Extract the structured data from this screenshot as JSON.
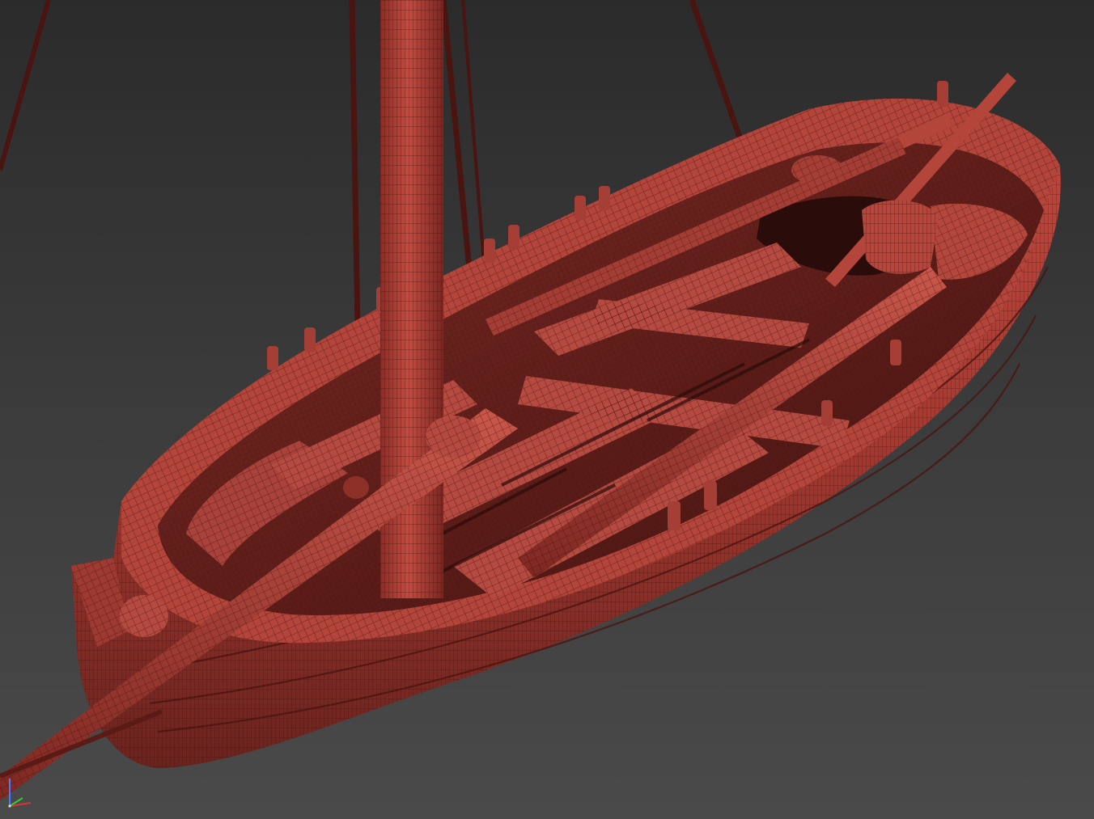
{
  "viewport": {
    "background_top": "#2b2b2b",
    "background_bottom": "#4a4a4a",
    "render_mode": "wireframe-on-shaded"
  },
  "model": {
    "subject": "rowing-boat-with-mast",
    "shade_color": "#b5443a",
    "shade_dark": "#6e2420",
    "wire_color": "#3a0d0b"
  },
  "gizmo": {
    "axes": [
      {
        "axis": "z",
        "color": "#4a7bff"
      },
      {
        "axis": "x",
        "color": "#e03030"
      },
      {
        "axis": "y",
        "color": "#30d030"
      }
    ]
  }
}
